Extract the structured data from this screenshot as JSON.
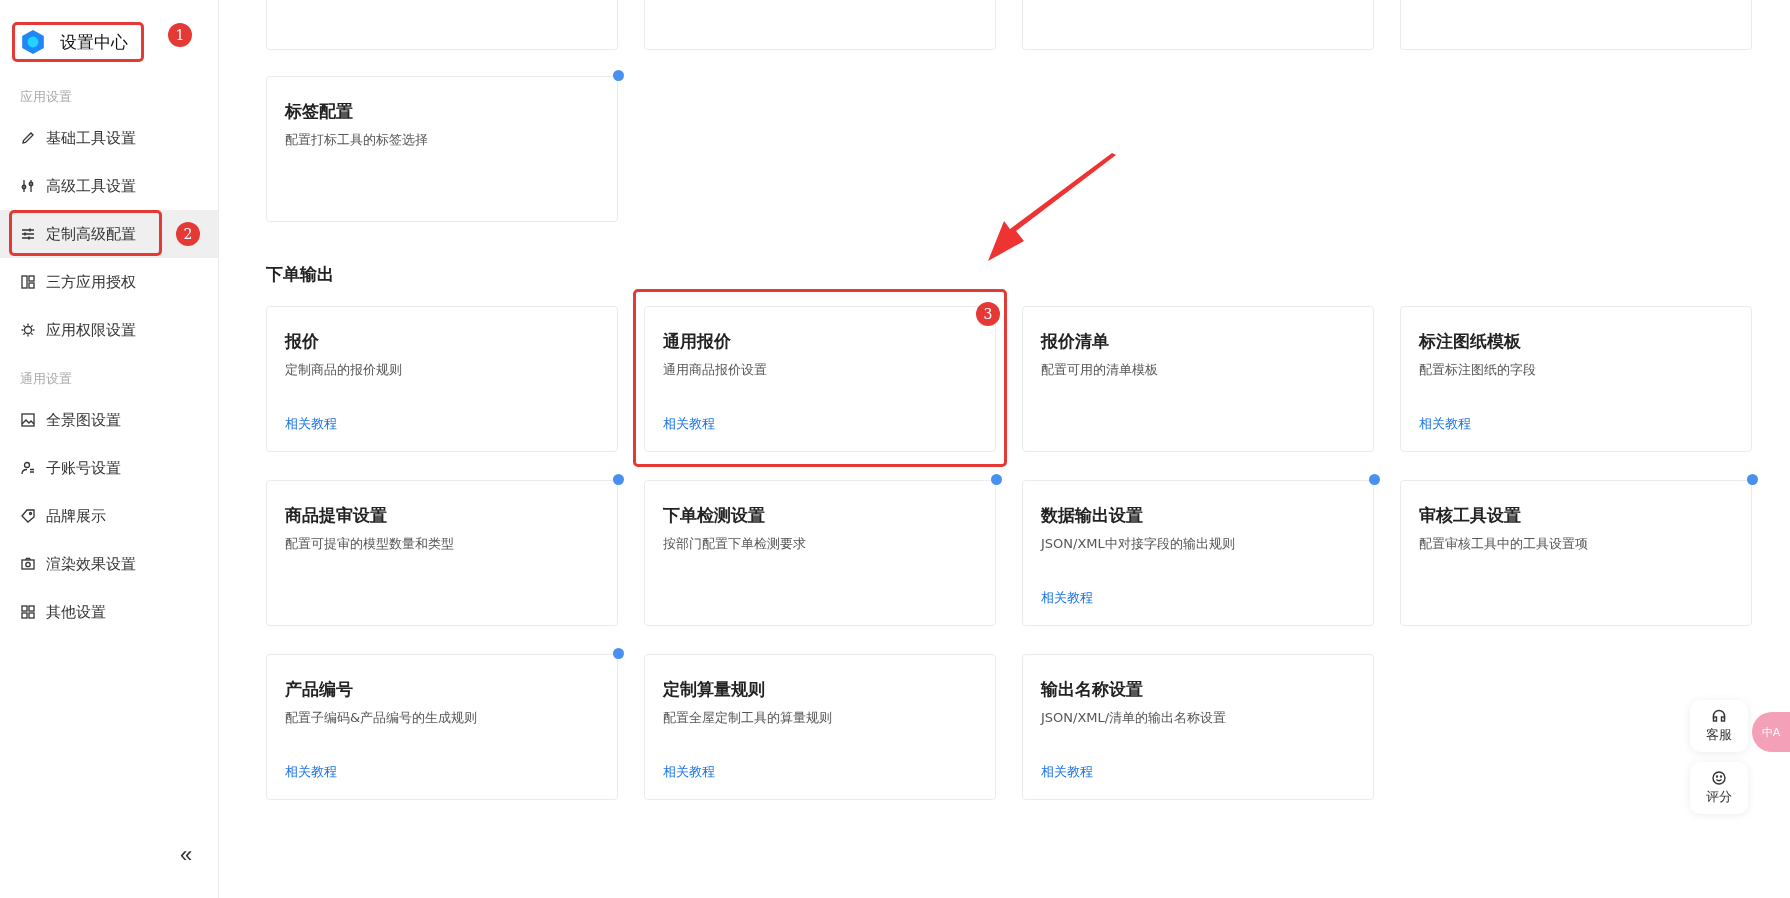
{
  "sidebar": {
    "logo": {
      "title": "设置中心",
      "annotation": "1"
    },
    "groups": [
      {
        "label": "应用设置",
        "items": [
          {
            "label": "基础工具设置",
            "selected": false
          },
          {
            "label": "高级工具设置",
            "selected": false
          },
          {
            "label": "定制高级配置",
            "selected": true,
            "annotation": "2"
          },
          {
            "label": "三方应用授权",
            "selected": false
          },
          {
            "label": "应用权限设置",
            "selected": false
          }
        ]
      },
      {
        "label": "通用设置",
        "items": [
          {
            "label": "全景图设置",
            "selected": false
          },
          {
            "label": "子账号设置",
            "selected": false
          },
          {
            "label": "品牌展示",
            "selected": false
          },
          {
            "label": "渲染效果设置",
            "selected": false
          },
          {
            "label": "其他设置",
            "selected": false
          }
        ]
      }
    ],
    "collapse": "«"
  },
  "upper_cards": [
    {
      "title": "标签配置",
      "description": "配置打标工具的标签选择",
      "dot": true
    }
  ],
  "section": {
    "title": "下单输出",
    "cards": [
      {
        "title": "报价",
        "description": "定制商品的报价规则",
        "link": "相关教程",
        "dot": false
      },
      {
        "title": "通用报价",
        "description": "通用商品报价设置",
        "link": "相关教程",
        "dot": false,
        "annotation": "3"
      },
      {
        "title": "报价清单",
        "description": "配置可用的清单模板",
        "dot": false
      },
      {
        "title": "标注图纸模板",
        "description": "配置标注图纸的字段",
        "link": "相关教程",
        "dot": false
      },
      {
        "title": "商品提审设置",
        "description": "配置可提审的模型数量和类型",
        "dot": true
      },
      {
        "title": "下单检测设置",
        "description": "按部门配置下单检测要求",
        "dot": true
      },
      {
        "title": "数据输出设置",
        "description": "JSON/XML中对接字段的输出规则",
        "link": "相关教程",
        "dot": true
      },
      {
        "title": "审核工具设置",
        "description": "配置审核工具中的工具设置项",
        "dot": true
      },
      {
        "title": "产品编号",
        "description": "配置子编码&产品编号的生成规则",
        "link": "相关教程",
        "dot": true
      },
      {
        "title": "定制算量规则",
        "description": "配置全屋定制工具的算量规则",
        "link": "相关教程",
        "dot": false
      },
      {
        "title": "输出名称设置",
        "description": "JSON/XML/清单的输出名称设置",
        "link": "相关教程",
        "dot": false
      }
    ]
  },
  "float_buttons": [
    {
      "label": "客服"
    },
    {
      "label": "评分"
    }
  ],
  "translate_bubble": "中A"
}
